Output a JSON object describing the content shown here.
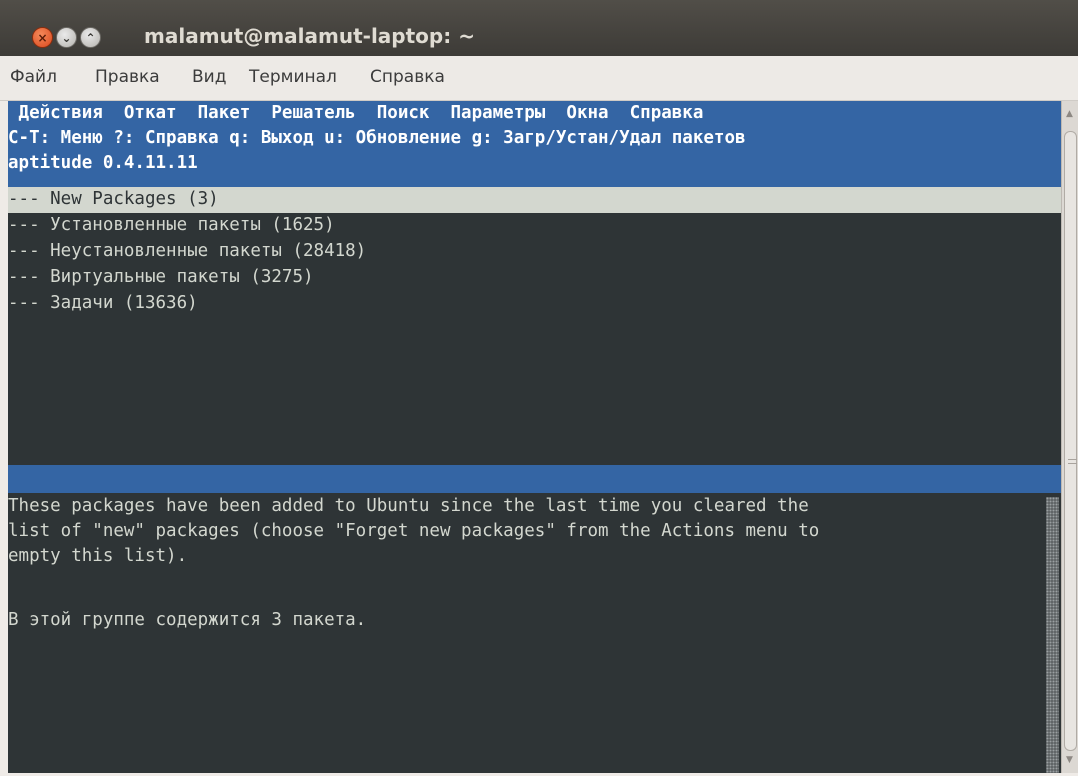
{
  "window": {
    "title": "malamut@malamut-laptop: ~",
    "buttons": {
      "close": "×",
      "minimize": "⌄",
      "maximize": "⌃"
    }
  },
  "menubar": {
    "items": [
      "Файл",
      "Правка",
      "Вид",
      "Терминал",
      "Справка"
    ]
  },
  "aptitude": {
    "menu_line": " Действия  Откат  Пакет  Решатель  Поиск  Параметры  Окна  Справка",
    "hint_line": "C-T: Меню ?: Справка q: Выход u: Обновление g: Загр/Устан/Удал пакетов",
    "version_line": "aptitude 0.4.11.11",
    "groups": [
      "--- New Packages (3)",
      "--- Установленные пакеты (1625)",
      "--- Неустановленные пакеты (28418)",
      "--- Виртуальные пакеты (3275)",
      "--- Задачи (13636)"
    ],
    "selected_index": 0,
    "description_lines": [
      "These packages have been added to Ubuntu since the last time you cleared the",
      "list of \"new\" packages (choose \"Forget new packages\" from the Actions menu to",
      "empty this list).",
      "",
      "В этой группе содержится 3 пакета."
    ]
  },
  "scrollbar": {
    "up_arrow": "▲",
    "down_arrow": "▼"
  },
  "colors": {
    "terminal_bg": "#2e3436",
    "terminal_fg": "#d3d7cf",
    "header_blue": "#3465a4",
    "selection": "#d3d7cf",
    "titlebar": "#3d3b37"
  }
}
